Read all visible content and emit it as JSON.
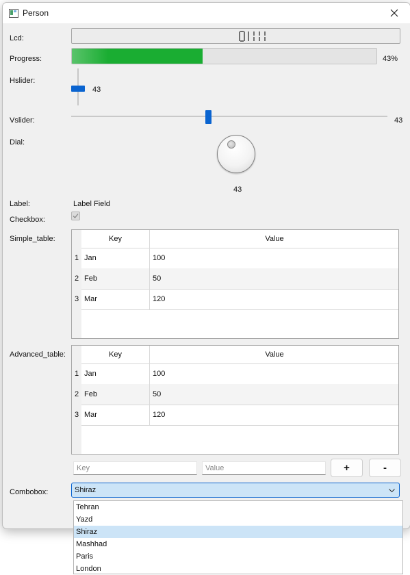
{
  "window": {
    "title": "Person"
  },
  "labels": {
    "lcd": "Lcd:",
    "progress": "Progress:",
    "hslider": "Hslider:",
    "vslider": "Vslider:",
    "dial": "Dial:",
    "label": "Label:",
    "checkbox": "Checkbox:",
    "simple_table": "Simple_table:",
    "advanced_table": "Advanced_table:",
    "combobox": "Combobox:"
  },
  "lcd": {
    "display": "43"
  },
  "progress": {
    "value": 43,
    "text": "43%"
  },
  "hslider": {
    "value": "43"
  },
  "vslider": {
    "value": "43"
  },
  "dial": {
    "value": "43"
  },
  "label_field": {
    "text": "Label Field"
  },
  "checkbox": {
    "checked": true
  },
  "simple_table": {
    "headers": {
      "key": "Key",
      "value": "Value"
    },
    "rows": [
      {
        "num": "1",
        "key": "Jan",
        "value": "100"
      },
      {
        "num": "2",
        "key": "Feb",
        "value": "50"
      },
      {
        "num": "3",
        "key": "Mar",
        "value": "120"
      }
    ]
  },
  "advanced_table": {
    "headers": {
      "key": "Key",
      "value": "Value"
    },
    "rows": [
      {
        "num": "1",
        "key": "Jan",
        "value": "100"
      },
      {
        "num": "2",
        "key": "Feb",
        "value": "50"
      },
      {
        "num": "3",
        "key": "Mar",
        "value": "120"
      }
    ],
    "key_placeholder": "Key",
    "value_placeholder": "Value",
    "add_label": "+",
    "remove_label": "-"
  },
  "combobox": {
    "selected": "Shiraz",
    "options": [
      "Tehran",
      "Yazd",
      "Shiraz",
      "Mashhad",
      "Paris",
      "London"
    ]
  },
  "colors": {
    "progress_fill": "#1aad32",
    "slider_handle": "#0a64d0",
    "selection": "#cce4f7"
  }
}
